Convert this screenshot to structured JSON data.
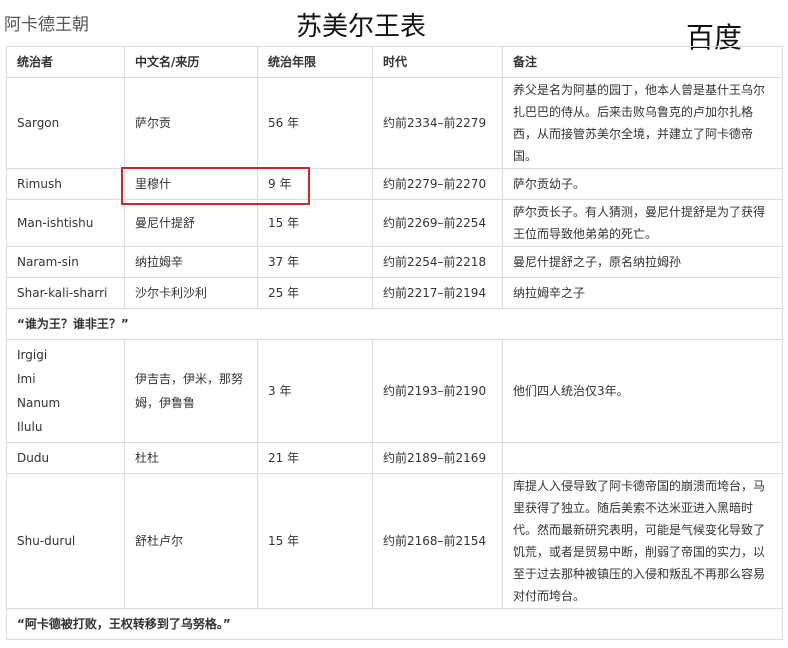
{
  "page": {
    "title": "阿卡德王朝"
  },
  "overlay": {
    "title": "苏美尔王表",
    "watermark": "百度"
  },
  "table": {
    "headers": [
      "统治者",
      "中文名/来历",
      "统治年限",
      "时代",
      "备注"
    ],
    "rows": [
      {
        "ruler": "Sargon",
        "chinese": "萨尔贡",
        "years": "56 年",
        "era": "约前2334–前2279",
        "note": "养父是名为阿基的园丁，他本人曾是基什王乌尔扎巴巴的侍从。后来击败乌鲁克的卢加尔扎格西，从而接管苏美尔全境，并建立了阿卡德帝国。"
      },
      {
        "ruler": "Rimush",
        "chinese": "里穆什",
        "years": "9 年",
        "era": "约前2279–前2270",
        "note": "萨尔贡幼子。"
      },
      {
        "ruler": "Man-ishtishu",
        "chinese": "曼尼什提舒",
        "years": "15 年",
        "era": "约前2269–前2254",
        "note": "萨尔贡长子。有人猜测，曼尼什提舒是为了获得王位而导致他弟弟的死亡。"
      },
      {
        "ruler": "Naram-sin",
        "chinese": "纳拉姆辛",
        "years": "37 年",
        "era": "约前2254–前2218",
        "note": "曼尼什提舒之子，原名纳拉姆孙"
      },
      {
        "ruler": "Shar-kali-sharri",
        "chinese": "沙尔卡利沙利",
        "years": "25 年",
        "era": "约前2217–前2194",
        "note": "纳拉姆辛之子"
      }
    ],
    "section1": "“谁为王？谁非王？”",
    "group": {
      "rulers": [
        "Irgigi",
        "Imi",
        "Nanum",
        "Ilulu"
      ],
      "chinese": "伊吉吉，伊米，那努姆，伊鲁鲁",
      "years": "3 年",
      "era": "约前2193–前2190",
      "note": "他们四人统治仅3年。"
    },
    "rows2": [
      {
        "ruler": "Dudu",
        "chinese": "杜杜",
        "years": "21 年",
        "era": "约前2189–前2169",
        "note": ""
      },
      {
        "ruler": "Shu-durul",
        "chinese": "舒杜卢尔",
        "years": "15 年",
        "era": "约前2168–前2154",
        "note": "库提人入侵导致了阿卡德帝国的崩溃而垮台，马里获得了独立。随后美索不达米亚进入黑暗时代。然而最新研究表明，可能是气候变化导致了饥荒，或者是贸易中断，削弱了帝国的实力，以至于过去那种被镇压的入侵和叛乱不再那么容易对付而垮台。"
      }
    ],
    "section2": "“阿卡德被打败，王权转移到了乌努格。”"
  },
  "annotation": {
    "color": "#d0252a"
  }
}
